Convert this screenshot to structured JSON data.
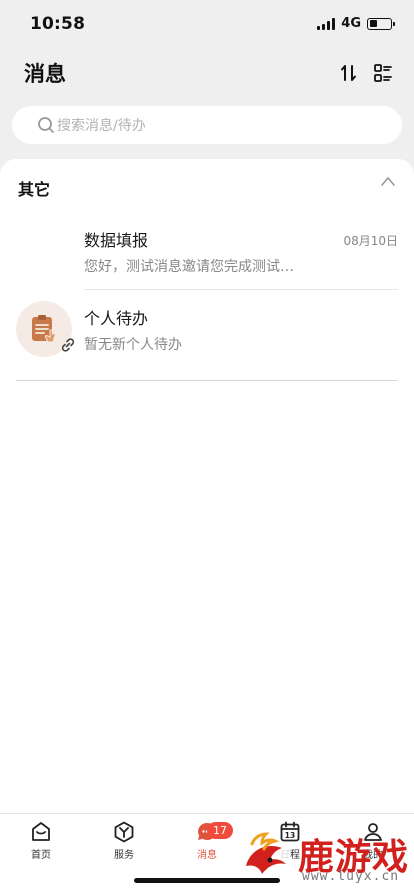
{
  "status": {
    "time": "10:58",
    "network": "4G"
  },
  "header": {
    "title": "消息"
  },
  "search": {
    "placeholder": "搜索消息/待办"
  },
  "section": {
    "title": "其它"
  },
  "messages": [
    {
      "title": "数据填报",
      "subtitle": "您好，测试消息邀请您完成测试…",
      "date": "08月10日"
    },
    {
      "title": "个人待办",
      "subtitle": "暂无新个人待办"
    }
  ],
  "tabs": [
    {
      "label": "首页",
      "icon": "home-icon"
    },
    {
      "label": "服务",
      "icon": "service-cube-icon"
    },
    {
      "label": "消息",
      "icon": "message-icon",
      "badge": "17",
      "active": true
    },
    {
      "label": "日程",
      "icon": "calendar-icon"
    },
    {
      "label": "我的",
      "icon": "user-icon"
    }
  ],
  "watermark": {
    "text": "鹿游戏",
    "url": "www.luyx.cn"
  },
  "colors": {
    "accent": "#e0533d",
    "badge": "#f04b3c",
    "avatar_bg": "#f6ebe4",
    "avatar_icon": "#c8794a"
  }
}
